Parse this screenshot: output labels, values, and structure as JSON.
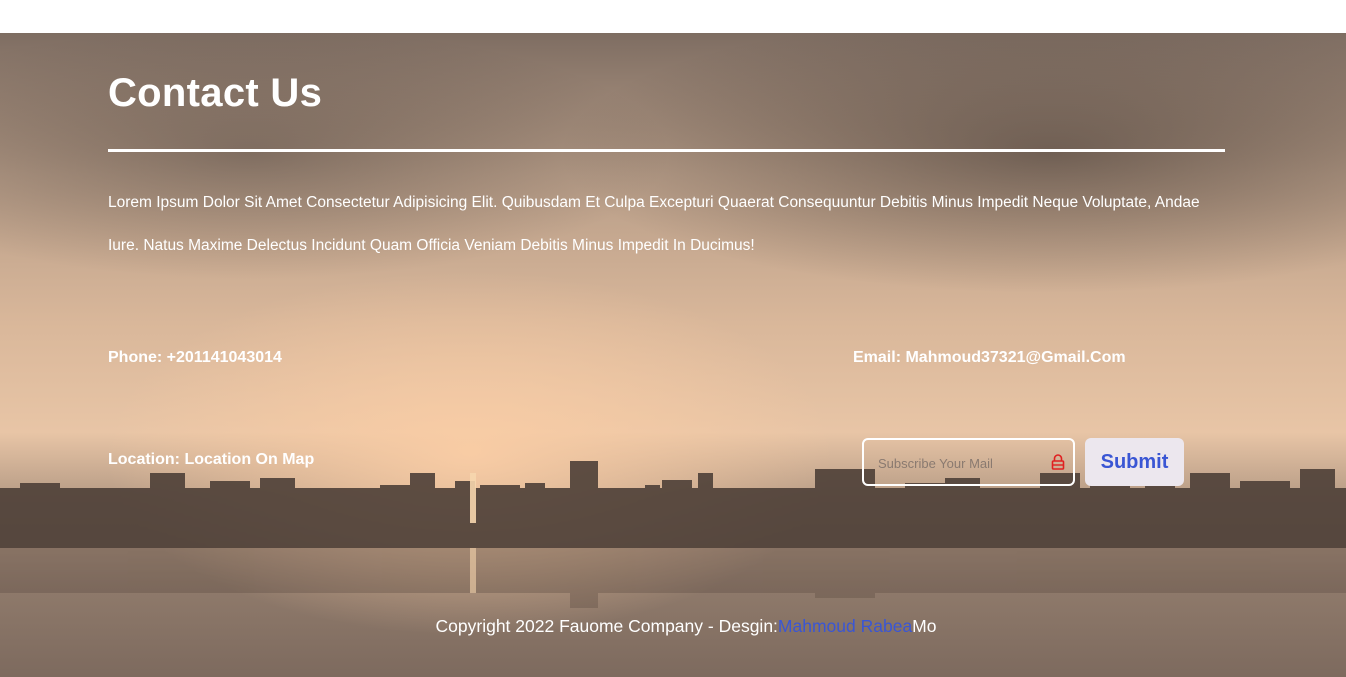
{
  "contact": {
    "title": "Contact Us",
    "intro": "Lorem Ipsum Dolor Sit Amet Consectetur Adipisicing Elit. Quibusdam Et Culpa Excepturi Quaerat Consequuntur Debitis Minus Impedit Neque Voluptate, Andae Iure. Natus Maxime Delectus Incidunt Quam Officia Veniam Debitis Minus Impedit In Ducimus!",
    "phone": "Phone: +201141043014",
    "email": "Email: Mahmoud37321@Gmail.Com",
    "location": "Location: Location On Map"
  },
  "subscribe": {
    "placeholder": "Subscribe Your Mail",
    "icon": "lock-icon",
    "submit_label": "Submit"
  },
  "footer": {
    "copyright": "Copyright 2022 Fauome Company - Desgin:",
    "author": "Mahmoud Rabea",
    "suffix": "Mo"
  },
  "colors": {
    "accent": "#3a56d4",
    "text": "#ffffff",
    "button_bg": "#ece7ee"
  }
}
